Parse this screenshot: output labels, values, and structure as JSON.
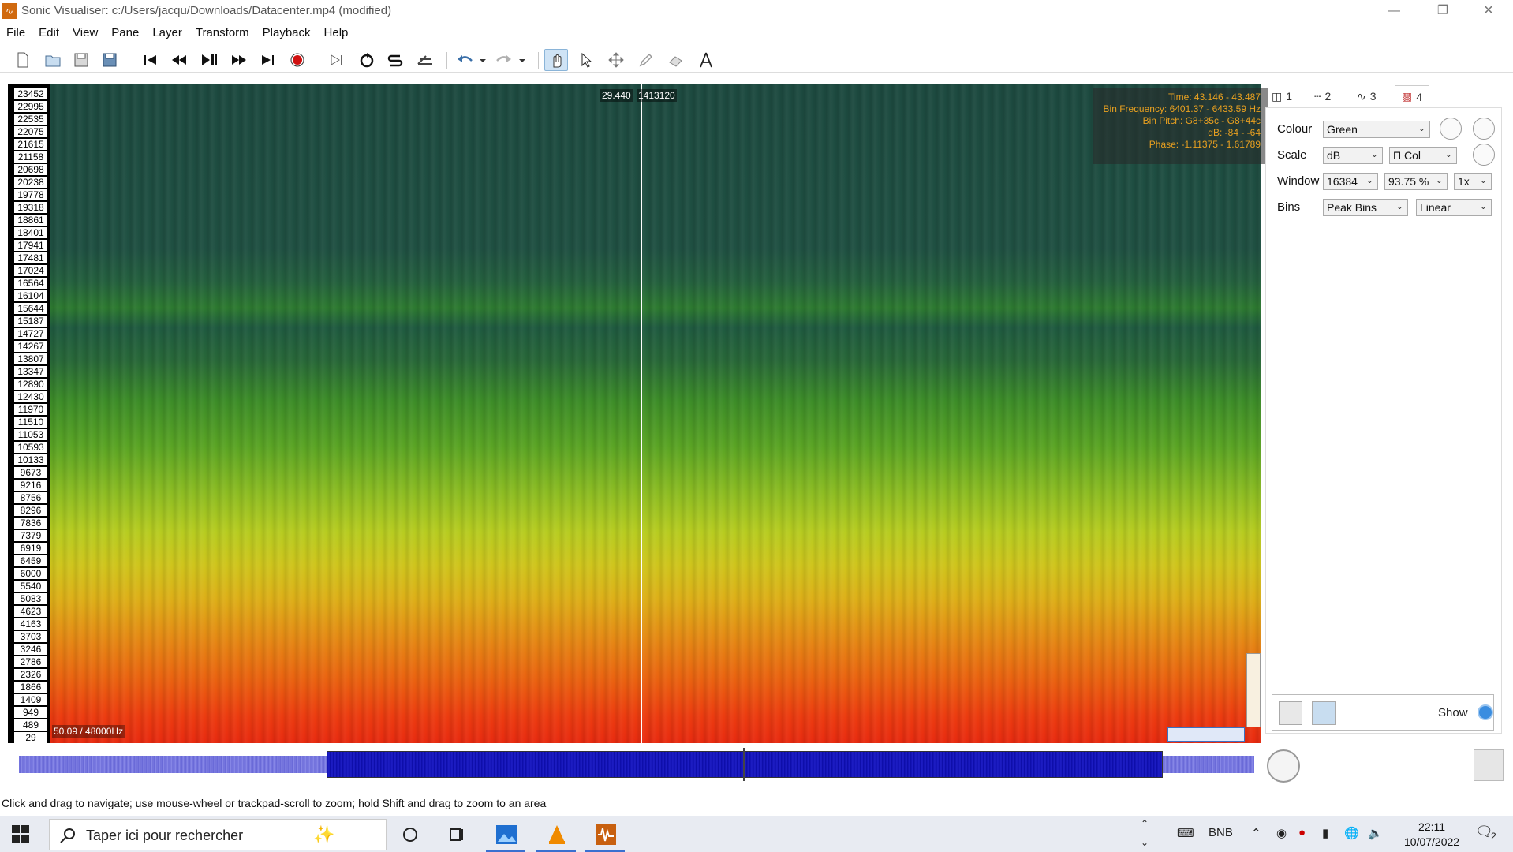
{
  "window": {
    "title": "Sonic Visualiser: c:/Users/jacqu/Downloads/Datacenter.mp4 (modified)",
    "icon": "app-waveform-icon"
  },
  "menu": [
    "File",
    "Edit",
    "View",
    "Pane",
    "Layer",
    "Transform",
    "Playback",
    "Help"
  ],
  "toolbar": {
    "icons": [
      "new-file-icon",
      "open-file-icon",
      "save-icon",
      "save-as-icon",
      "rewind-start-icon",
      "rewind-icon",
      "play-pause-icon",
      "fast-forward-icon",
      "fast-forward-end-icon",
      "record-icon",
      "constrain-playback-icon",
      "loop-icon",
      "solo-icon",
      "follow-playback-icon",
      "undo-icon",
      "undo-dropdown-icon",
      "redo-icon",
      "redo-dropdown-icon",
      "navigate-tool-icon",
      "select-tool-icon",
      "move-tool-icon",
      "draw-tool-icon",
      "erase-tool-icon",
      "measure-tool-icon"
    ],
    "active_tool": "navigate"
  },
  "pane": {
    "freq_labels": [
      "23452",
      "22995",
      "22535",
      "22075",
      "21615",
      "21158",
      "20698",
      "20238",
      "19778",
      "19318",
      "18861",
      "18401",
      "17941",
      "17481",
      "17024",
      "16564",
      "16104",
      "15644",
      "15187",
      "14727",
      "14267",
      "13807",
      "13347",
      "12890",
      "12430",
      "11970",
      "11510",
      "11053",
      "10593",
      "10133",
      "9673",
      "9216",
      "8756",
      "8296",
      "7836",
      "7379",
      "6919",
      "6459",
      "6000",
      "5540",
      "5083",
      "4623",
      "4163",
      "3703",
      "3246",
      "2786",
      "2326",
      "1866",
      "1409",
      "949",
      "489",
      "29"
    ],
    "cursor_time": "29.440",
    "cursor_frame": "1413120",
    "info": {
      "time": "Time: 43.146 - 43.487",
      "bin_frequency": "Bin Frequency: 6401.37 - 6433.59 Hz",
      "bin_pitch": "Bin Pitch: G8+35c - G8+44c",
      "db": "dB: -84 - -64",
      "phase": "Phase: -1.11375 - 1.61789"
    },
    "rate_label": "50.09 / 48000Hz"
  },
  "tabs": [
    {
      "icon": "pane-icon",
      "label": "1"
    },
    {
      "icon": "ruler-icon",
      "label": "2"
    },
    {
      "icon": "waveform-icon",
      "label": "3"
    },
    {
      "icon": "spectrogram-icon",
      "label": "4"
    }
  ],
  "properties": {
    "colour_label": "Colour",
    "colour_value": "Green",
    "scale_label": "Scale",
    "scale_value": "dB",
    "scale_norm": "Π Col",
    "window_label": "Window",
    "window_size": "16384",
    "window_overlap": "93.75 %",
    "window_oversample": "1x",
    "bins_label": "Bins",
    "bins_value": "Peak Bins",
    "bins_scale": "Linear",
    "show_label": "Show"
  },
  "status_text": "Click and drag to navigate; use mouse-wheel or trackpad-scroll to zoom; hold Shift and drag to zoom to an area",
  "taskbar": {
    "search_placeholder": "Taper ici pour rechercher",
    "keyboard": "BNB",
    "time": "22:11",
    "date": "10/07/2022",
    "notifications": "2"
  }
}
